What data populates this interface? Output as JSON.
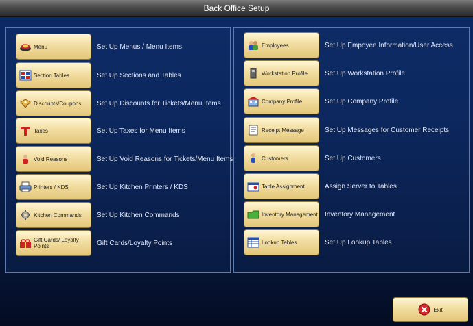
{
  "window": {
    "title": "Back Office Setup"
  },
  "left_items": [
    {
      "label": "Menu",
      "description": "Set Up Menus /  Menu Items",
      "icon": "menu-icon"
    },
    {
      "label": "Section Tables",
      "description": "Set Up Sections  and Tables",
      "icon": "section-tables-icon"
    },
    {
      "label": "Discounts/Coupons",
      "description": "Set Up Discounts for Tickets/Menu Items",
      "icon": "discounts-icon"
    },
    {
      "label": "Taxes",
      "description": "Set Up Taxes for Menu Items",
      "icon": "taxes-icon"
    },
    {
      "label": "Void Reasons",
      "description": "Set Up Void Reasons for Tickets/Menu Items",
      "icon": "void-reasons-icon"
    },
    {
      "label": "Printers / KDS",
      "description": "Set Up Kitchen Printers / KDS",
      "icon": "printer-icon"
    },
    {
      "label": "Kitchen Commands",
      "description": "Set Up Kitchen Commands",
      "icon": "kitchen-commands-icon"
    },
    {
      "label": "Gift Cards/ Loyalty Points",
      "description": "Gift Cards/Loyalty Points",
      "icon": "gift-cards-icon"
    }
  ],
  "right_items": [
    {
      "label": "Employees",
      "description": "Set Up Empoyee Information/User Access",
      "icon": "employees-icon"
    },
    {
      "label": "Workstation Profile",
      "description": "Set Up Workstation Profile",
      "icon": "workstation-icon"
    },
    {
      "label": "Company Profile",
      "description": "Set Up Company Profile",
      "icon": "company-icon"
    },
    {
      "label": "Receipt Message",
      "description": "Set Up Messages for Customer Receipts",
      "icon": "receipt-icon"
    },
    {
      "label": "Customers",
      "description": "Set Up Customers",
      "icon": "customers-icon"
    },
    {
      "label": "Table Assignment",
      "description": "Assign Server to Tables",
      "icon": "table-assignment-icon"
    },
    {
      "label": "Inventory Management",
      "description": "Inventory Management",
      "icon": "inventory-icon"
    },
    {
      "label": "Lookup Tables",
      "description": "Set Up Lookup Tables",
      "icon": "lookup-tables-icon"
    }
  ],
  "exit": {
    "label": "Exit",
    "icon": "exit-icon"
  }
}
